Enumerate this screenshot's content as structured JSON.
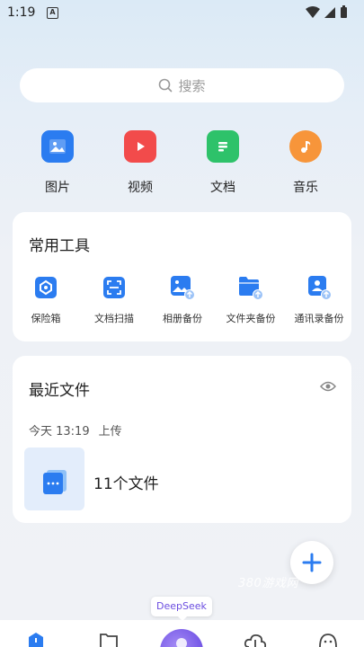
{
  "status_bar": {
    "time": "1:19",
    "notif_badge": "A"
  },
  "search": {
    "placeholder": "搜索"
  },
  "quick_access": [
    {
      "label": "图片",
      "icon": "image-icon",
      "color": "#2b7cf0"
    },
    {
      "label": "视频",
      "icon": "video-icon",
      "color": "#f24b4b"
    },
    {
      "label": "文档",
      "icon": "document-icon",
      "color": "#2ec26a"
    },
    {
      "label": "音乐",
      "icon": "music-icon",
      "color": "#f7953a"
    }
  ],
  "tools": {
    "title": "常用工具",
    "items": [
      {
        "label": "保险箱",
        "icon": "safe-icon"
      },
      {
        "label": "文档扫描",
        "icon": "scan-icon"
      },
      {
        "label": "相册备份",
        "icon": "album-backup-icon"
      },
      {
        "label": "文件夹备份",
        "icon": "folder-backup-icon"
      },
      {
        "label": "通讯录备份",
        "icon": "contacts-backup-icon"
      }
    ]
  },
  "recent": {
    "title": "最近文件",
    "time": "今天 13:19",
    "action": "上传",
    "file_count": "11个文件"
  },
  "fab": {
    "icon": "plus-icon"
  },
  "watermark": "380游戏网",
  "deepseek": {
    "label": "DeepSeek"
  },
  "bottom_nav": [
    {
      "icon": "home-icon"
    },
    {
      "icon": "folder-icon"
    },
    {
      "icon": "deepseek-icon"
    },
    {
      "icon": "cloud-icon"
    },
    {
      "icon": "profile-icon"
    }
  ],
  "colors": {
    "accent": "#2b7cf0",
    "deepseek": "#6b4de0"
  }
}
